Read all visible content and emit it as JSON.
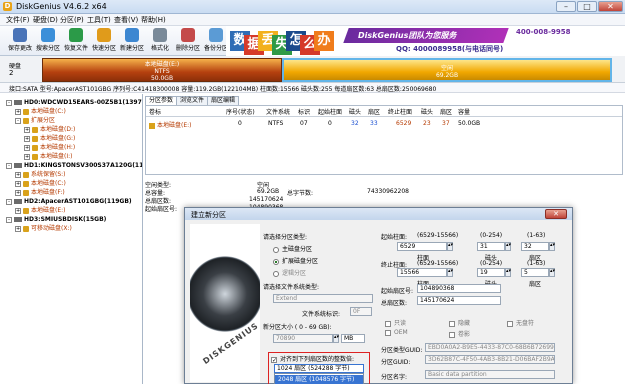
{
  "window": {
    "title": "DiskGenius V4.6.2 x64",
    "min_glyph": "–",
    "max_glyph": "□",
    "close_glyph": "✕"
  },
  "menu": [
    "文件(F)",
    "硬盘(D)",
    "分区(P)",
    "工具(T)",
    "查看(V)",
    "帮助(H)"
  ],
  "toolbar": [
    {
      "label": "保存更改",
      "icon": "save-icon",
      "color": "#4a74b8"
    },
    {
      "label": "搜索分区",
      "icon": "search-icon",
      "color": "#3b8fd9"
    },
    {
      "label": "恢复文件",
      "icon": "recover-file-icon",
      "color": "#2b9a48"
    },
    {
      "label": "快速分区",
      "icon": "quick-partition-icon",
      "color": "#e09b1b"
    },
    {
      "label": "新建分区",
      "icon": "new-partition-icon",
      "color": "#3d87d1"
    },
    {
      "label": "格式化",
      "icon": "format-icon",
      "color": "#7a8a99"
    },
    {
      "label": "删除分区",
      "icon": "delete-partition-icon",
      "color": "#c44a4a"
    },
    {
      "label": "备份分区",
      "icon": "backup-partition-icon",
      "color": "#5b9bd5"
    }
  ],
  "banner": {
    "tiles": [
      {
        "char": "数",
        "color": "#2f6db5"
      },
      {
        "char": "据",
        "color": "#d53a2a"
      },
      {
        "char": "丢",
        "color": "#f2b01d"
      },
      {
        "char": "失",
        "color": "#2f9a46"
      },
      {
        "char": "怎",
        "color": "#1b4a8c"
      },
      {
        "char": "么",
        "color": "#d53a2a"
      },
      {
        "char": "办",
        "color": "#f07c1b"
      }
    ],
    "brand": "DiskGenius团队为您服务",
    "tel": "400-008-9958",
    "qq": "QQ: 4000089958(与电话同号)"
  },
  "disk_map": {
    "label": "硬盘",
    "index": "2",
    "part1": {
      "name": "本地磁盘(E:)",
      "fs": "NTFS",
      "size": "50.0GB"
    },
    "part2": {
      "name": "空闲",
      "size": "69.2GB"
    }
  },
  "info_line": "接口:SATA  型号:ApacerAST101GBG  序列号:C41418300008  容量:119.2GB(122104MB)  柱面数:15566  磁头数:255  每道扇区数:63  总扇区数:250069680",
  "tree": [
    {
      "text": "HD0:WDCWD15EARS-00Z5B1(1397GB)",
      "level": 0,
      "type": "disk",
      "exp": "-"
    },
    {
      "text": "本地磁盘(C:)",
      "level": 1,
      "type": "part",
      "exp": "+"
    },
    {
      "text": "扩展分区",
      "level": 1,
      "type": "part",
      "exp": "-"
    },
    {
      "text": "本地磁盘(D:)",
      "level": 2,
      "type": "part",
      "exp": "+"
    },
    {
      "text": "本地磁盘(G:)",
      "level": 2,
      "type": "part",
      "exp": "+"
    },
    {
      "text": "本地磁盘(H:)",
      "level": 2,
      "type": "part",
      "exp": "+"
    },
    {
      "text": "本地磁盘(I:)",
      "level": 2,
      "type": "part",
      "exp": "+"
    },
    {
      "text": "HD1:KINGSTONSV300S37A120G(112GB)",
      "level": 0,
      "type": "disk",
      "exp": "-"
    },
    {
      "text": "系统保留(S:)",
      "level": 1,
      "type": "part",
      "exp": "+"
    },
    {
      "text": "本地磁盘(C:)",
      "level": 1,
      "type": "part",
      "exp": "+"
    },
    {
      "text": "本地磁盘(F:)",
      "level": 1,
      "type": "part",
      "exp": "+"
    },
    {
      "text": "HD2:ApacerAST101GBG(119GB)",
      "level": 0,
      "type": "disk",
      "exp": "-"
    },
    {
      "text": "本地磁盘(E:)",
      "level": 1,
      "type": "part",
      "exp": "+"
    },
    {
      "text": "HD3:SMIUSBDISK(15GB)",
      "level": 0,
      "type": "disk",
      "exp": "-"
    },
    {
      "text": "可移动磁盘(X:)",
      "level": 1,
      "type": "part",
      "exp": "+"
    }
  ],
  "tabs": [
    "分区参数",
    "浏览文件",
    "扇区编辑"
  ],
  "table": {
    "headers": [
      "卷标",
      "序号(状态)",
      "文件系统",
      "标识",
      "起始柱面",
      "磁头",
      "扇区",
      "终止柱面",
      "磁头",
      "扇区",
      "容量"
    ],
    "row": [
      "本地磁盘(E:)",
      "0",
      "NTFS",
      "07",
      "0",
      "32",
      "33",
      "6529",
      "23",
      "37",
      "50.0GB"
    ]
  },
  "details": {
    "left_labels": [
      "空闲类型:",
      "总容量:",
      "总扇区数:",
      "起始扇区号:"
    ],
    "left_values": [
      "空闲",
      "69.2GB",
      "145170624",
      "104890368"
    ],
    "right_label": "总字节数:",
    "right_value": "74330962208"
  },
  "dialog": {
    "title": "建立新分区",
    "close": "✕",
    "art_text": "DISKGENIUS",
    "type_label": "请选择分区类型:",
    "types": [
      "主磁盘分区",
      "扩展磁盘分区",
      "逻辑分区"
    ],
    "fs_label": "请选择文件系统类型:",
    "fs_value": "Extend",
    "fs_id_label": "文件系统标识:",
    "fs_id_value": "0F",
    "size_label": "新分区大小 ( 0 - 69 GB):",
    "size_value": "70890",
    "size_unit": "MB",
    "align_label": "对齐到下列扇区数的整数倍:",
    "align_value": "1024 扇区 (524288 字节)",
    "align_options": [
      "2048 扇区 (1048576 字节)",
      "1024 扇区 (524288 字节)"
    ],
    "start_label": "起始柱面:",
    "start_ranges": [
      "(6529-15566)",
      "(0-254)",
      "(1-63)"
    ],
    "start_values": [
      "6529",
      "31",
      "32"
    ],
    "start_sub": [
      "柱面",
      "磁头",
      "扇区"
    ],
    "end_label": "终止柱面:",
    "end_ranges": [
      "(6529-15566)",
      "(0-254)",
      "(1-63)"
    ],
    "end_values": [
      "15566",
      "19",
      "5"
    ],
    "end_sub": [
      "柱面",
      "磁头",
      "扇区"
    ],
    "start_sector_label": "起始扇区号:",
    "start_sector": "104890368",
    "total_sectors_label": "总扇区数:",
    "total_sectors": "145170624",
    "checkboxes": [
      "只读",
      "隐藏",
      "无盘符",
      "OEM",
      "卷影"
    ],
    "guid1_label": "分区类型GUID:",
    "guid1": "EBD0A0A2-B9E5-4433-87C0-68B6B72699C7",
    "guid2_label": "分区GUID:",
    "guid2": "3D62B87C-4F50-4AB3-8B21-D06BAF2B9AA0",
    "name_label": "分区名字:",
    "name_value": "Basic data partition"
  }
}
